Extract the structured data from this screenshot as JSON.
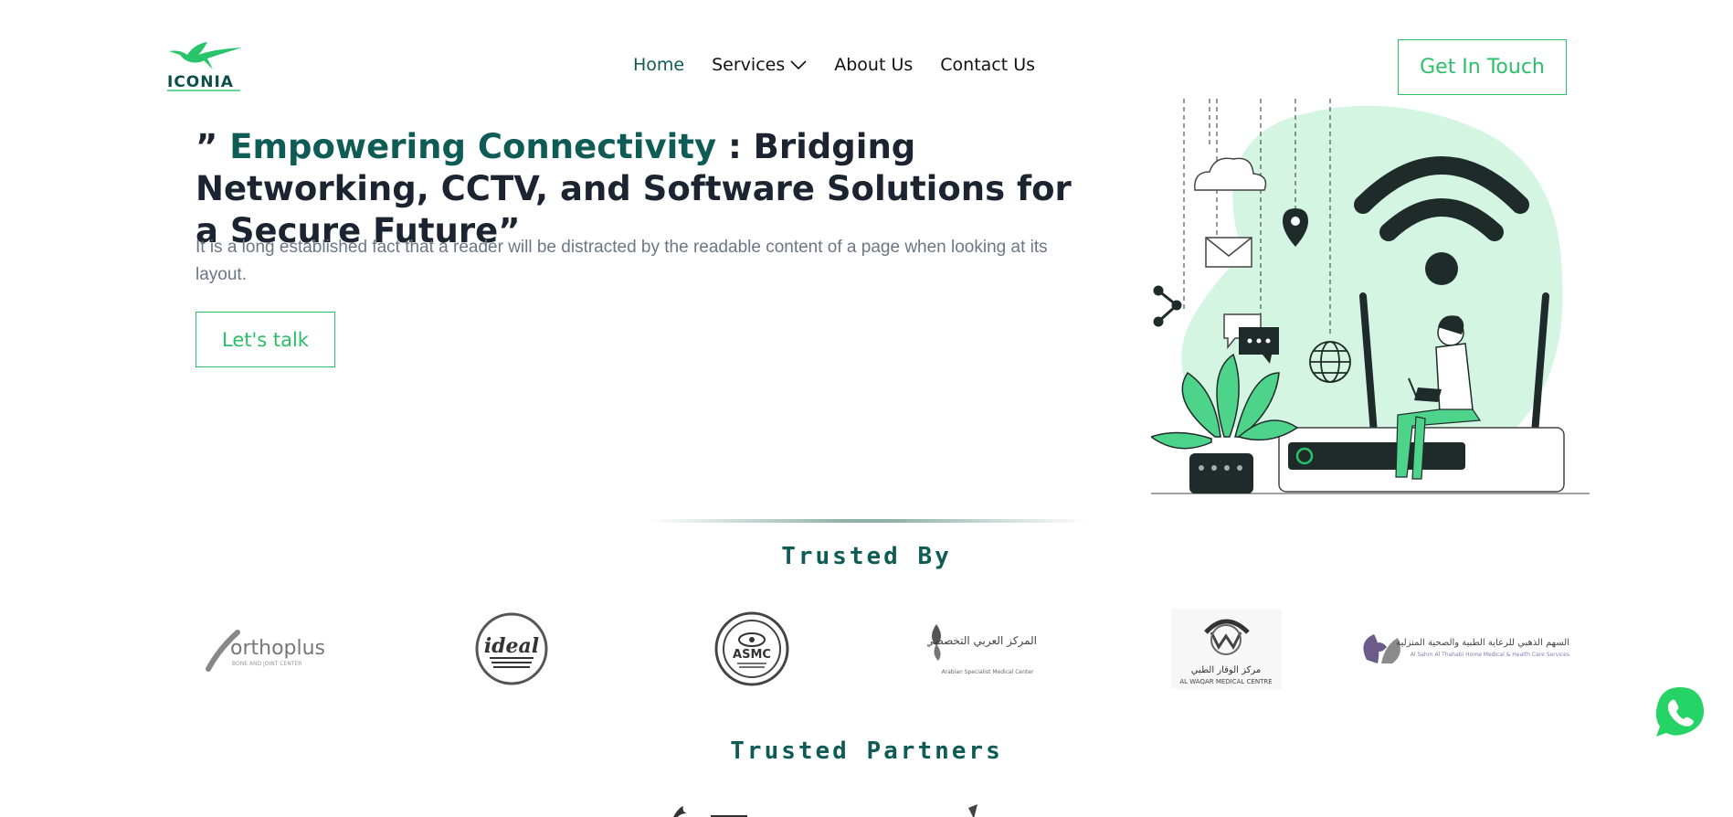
{
  "header": {
    "logo_text": "ICONIA",
    "nav": [
      {
        "label": "Home",
        "active": true
      },
      {
        "label": "Services",
        "has_dropdown": true
      },
      {
        "label": "About Us"
      },
      {
        "label": "Contact Us"
      }
    ],
    "cta_label": "Get In Touch"
  },
  "hero": {
    "quote_open": "” ",
    "title_accent": "Empowering Connectivity",
    "title_rest": " : Bridging Networking, CCTV, and Software Solutions for a Secure Future”",
    "subtitle": "It is a long established fact that a reader will be distracted by the readable content of a page when looking at its layout.",
    "button_label": "Let's talk"
  },
  "trusted_by": {
    "title": "Trusted By",
    "logos": [
      {
        "name": "orthoplus",
        "text": "orthoplus",
        "sub": "BONE AND JOINT CENTER"
      },
      {
        "name": "ideal",
        "text": "ideal"
      },
      {
        "name": "asmc",
        "text": "ASMC"
      },
      {
        "name": "arabian-specialist",
        "text": "المركز العربي التخصصي الطبي",
        "sub": "Arabian Specialist Medical Center"
      },
      {
        "name": "al-waqar",
        "text": "مركز الوقار الطبي",
        "sub": "AL WAQAR MEDICAL CENTRE"
      },
      {
        "name": "al-sahm",
        "text": "السهم الذهبي للرعاية الطبية والصحية المنزلية",
        "sub": "Al Sahm Al Thahabi Home Medical & Health Care Services"
      }
    ]
  },
  "trusted_partners": {
    "title": "Trusted Partners"
  },
  "colors": {
    "accent_green": "#2bbf68",
    "dark_teal": "#0f5b55",
    "mint": "#d4f5e2"
  },
  "icons": [
    "hummingbird-logo-icon",
    "chevron-down-icon",
    "whatsapp-icon",
    "wifi-icon",
    "cloud-icon",
    "location-pin-icon",
    "mail-icon",
    "share-icon",
    "chat-icon",
    "globe-icon"
  ]
}
